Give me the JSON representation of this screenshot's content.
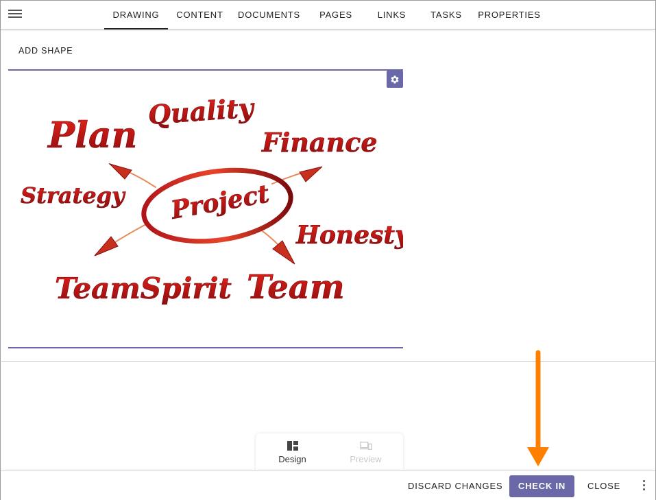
{
  "tabs": [
    {
      "label": "DRAWING",
      "active": true
    },
    {
      "label": "CONTENT",
      "active": false
    },
    {
      "label": "DOCUMENTS",
      "active": false
    },
    {
      "label": "PAGES",
      "active": false
    },
    {
      "label": "LINKS",
      "active": false
    },
    {
      "label": "TASKS",
      "active": false
    },
    {
      "label": "PROPERTIES",
      "active": false
    }
  ],
  "toolbar": {
    "add_shape_label": "ADD SHAPE"
  },
  "drawing": {
    "words": {
      "plan": "Plan",
      "quality": "Quality",
      "finance": "Finance",
      "strategy": "Strategy",
      "project": "Project",
      "honesty": "Honesty",
      "teamspirit": "TeamSpirit",
      "team": "Team"
    }
  },
  "mode_switch": {
    "design_label": "Design",
    "preview_label": "Preview"
  },
  "actions": {
    "discard_label": "DISCARD CHANGES",
    "checkin_label": "CHECK IN",
    "close_label": "CLOSE"
  },
  "colors": {
    "accent": "#6a68a8",
    "word_red": "#c0141a",
    "annotation": "#ff8000"
  },
  "icons": {
    "menu": "hamburger-icon",
    "settings": "gear-icon",
    "design": "dashboard-icon",
    "preview": "devices-icon",
    "more": "more-vertical-icon",
    "annotation": "arrow-down-icon"
  }
}
